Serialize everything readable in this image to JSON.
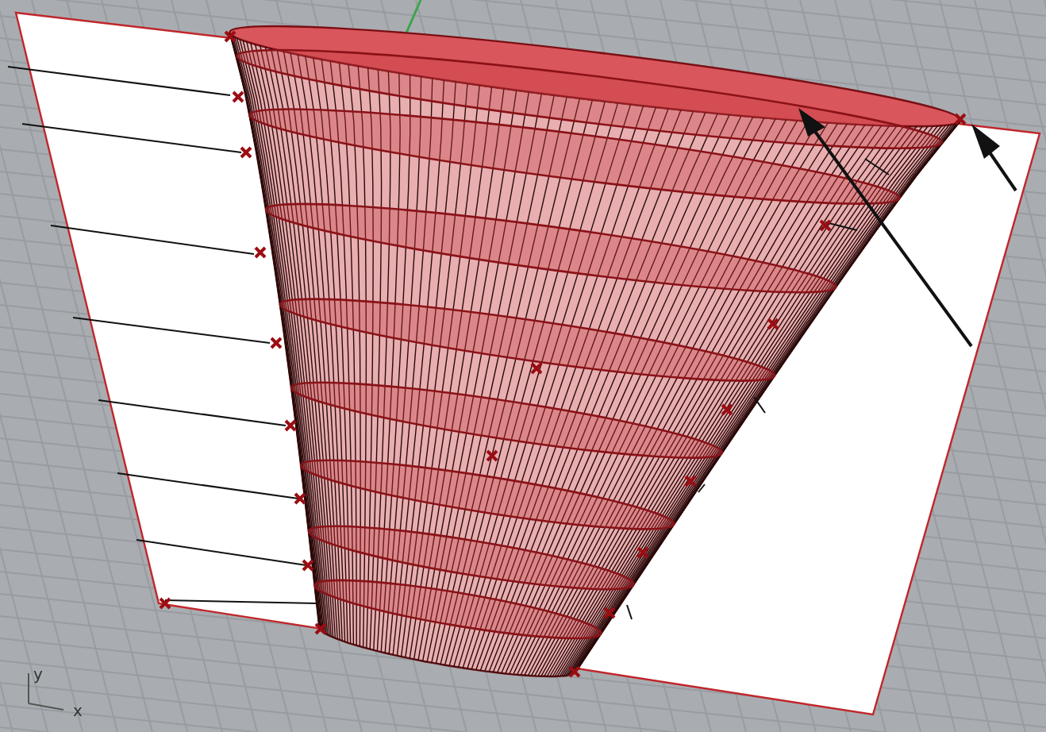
{
  "viewport": {
    "axis_labels": [
      {
        "kind": "y",
        "label": "y"
      },
      {
        "kind": "x",
        "label": "x"
      }
    ]
  }
}
